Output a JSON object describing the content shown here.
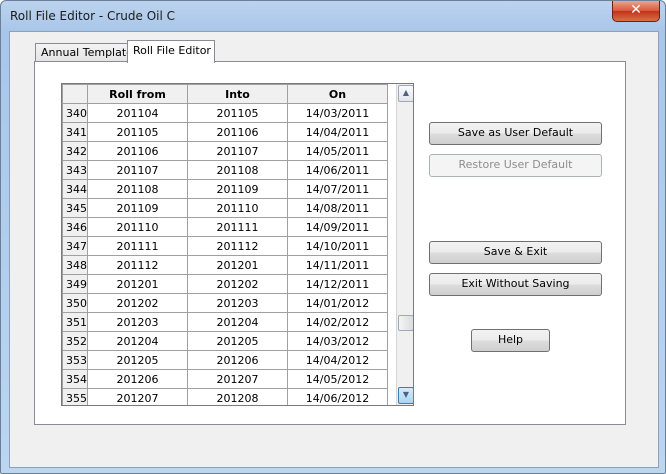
{
  "window": {
    "title": "Roll File Editor  -  Crude Oil C",
    "close_glyph": "✕"
  },
  "tabs": [
    {
      "label": "Annual Template",
      "active": false
    },
    {
      "label": "Roll File Editor",
      "active": true
    }
  ],
  "grid": {
    "columns": [
      "Roll from",
      "Into",
      "On"
    ],
    "rows": [
      {
        "n": "340",
        "from": "201104",
        "into": "201105",
        "on": "14/03/2011"
      },
      {
        "n": "341",
        "from": "201105",
        "into": "201106",
        "on": "14/04/2011"
      },
      {
        "n": "342",
        "from": "201106",
        "into": "201107",
        "on": "14/05/2011"
      },
      {
        "n": "343",
        "from": "201107",
        "into": "201108",
        "on": "14/06/2011"
      },
      {
        "n": "344",
        "from": "201108",
        "into": "201109",
        "on": "14/07/2011"
      },
      {
        "n": "345",
        "from": "201109",
        "into": "201110",
        "on": "14/08/2011"
      },
      {
        "n": "346",
        "from": "201110",
        "into": "201111",
        "on": "14/09/2011"
      },
      {
        "n": "347",
        "from": "201111",
        "into": "201112",
        "on": "14/10/2011"
      },
      {
        "n": "348",
        "from": "201112",
        "into": "201201",
        "on": "14/11/2011"
      },
      {
        "n": "349",
        "from": "201201",
        "into": "201202",
        "on": "14/12/2011"
      },
      {
        "n": "350",
        "from": "201202",
        "into": "201203",
        "on": "14/01/2012"
      },
      {
        "n": "351",
        "from": "201203",
        "into": "201204",
        "on": "14/02/2012"
      },
      {
        "n": "352",
        "from": "201204",
        "into": "201205",
        "on": "14/03/2012"
      },
      {
        "n": "353",
        "from": "201205",
        "into": "201206",
        "on": "14/04/2012"
      },
      {
        "n": "354",
        "from": "201206",
        "into": "201207",
        "on": "14/05/2012"
      },
      {
        "n": "355",
        "from": "201207",
        "into": "201208",
        "on": "14/06/2012"
      }
    ]
  },
  "scrollbar": {
    "up_glyph": "▲",
    "down_glyph": "▼"
  },
  "buttons": {
    "save_default": "Save as User Default",
    "restore_default": "Restore User Default",
    "save_exit": "Save & Exit",
    "exit_no_save": "Exit Without Saving",
    "help": "Help"
  }
}
